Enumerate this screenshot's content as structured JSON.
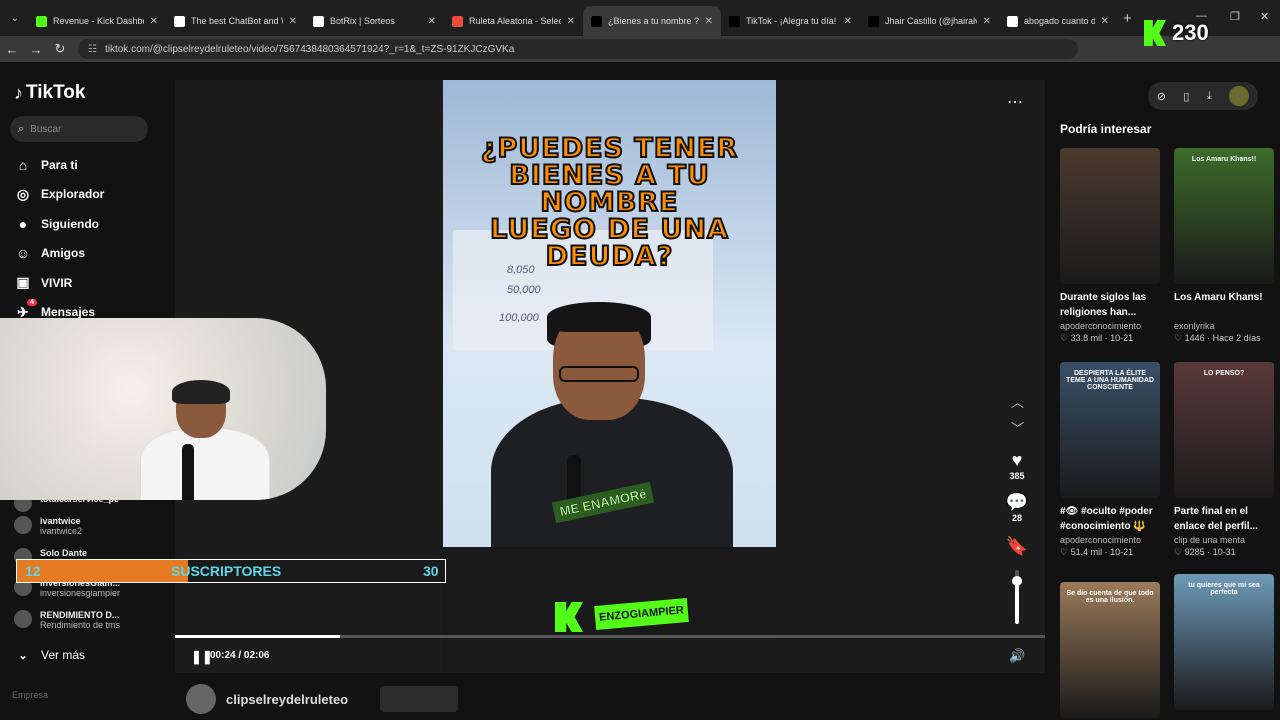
{
  "browser": {
    "tabs": [
      {
        "title": "Revenue - Kick Dashboard",
        "favicon": "kick",
        "active": false
      },
      {
        "title": "The best ChatBot and Wi",
        "favicon": "botrix",
        "active": false
      },
      {
        "title": "BotRix | Sorteos",
        "favicon": "botrix",
        "active": false
      },
      {
        "title": "Ruleta Aleatoria - Selector",
        "favicon": "wheel",
        "active": false
      },
      {
        "title": "¿Bienes a tu nombre ?",
        "favicon": "tiktok",
        "active": true
      },
      {
        "title": "TikTok - ¡Alegra tu día!",
        "favicon": "tiktok",
        "active": false
      },
      {
        "title": "Jhair Castillo (@jhairalvan",
        "favicon": "tiktok",
        "active": false
      },
      {
        "title": "abogado cuanto declara",
        "favicon": "google",
        "active": false
      }
    ],
    "url": "tiktok.com/@clipselreydelruleteo/video/7567438480364571924?_r=1&_t=ZS-91ZKJCzGVKa"
  },
  "overlay": {
    "kick_count": "230",
    "subs_current": "12",
    "subs_label": "SUSCRIPTORES",
    "subs_goal": "30",
    "subs_progress": 0.4
  },
  "sidebar": {
    "logo": "TikTok",
    "search_placeholder": "Buscar",
    "nav": [
      {
        "label": "Para ti",
        "icon": "home-icon"
      },
      {
        "label": "Explorador",
        "icon": "compass-icon"
      },
      {
        "label": "Siguiendo",
        "icon": "following-icon"
      },
      {
        "label": "Amigos",
        "icon": "friends-icon"
      },
      {
        "label": "VIVIR",
        "icon": "live-icon"
      },
      {
        "label": "Mensajes",
        "icon": "messages-icon",
        "badge": "4"
      }
    ],
    "following": [
      {
        "name": "totalcarservice_pe",
        "sub": ""
      },
      {
        "name": "ivantwice",
        "sub": "ivantwice2"
      },
      {
        "name": "Solo Dante",
        "sub": ""
      },
      {
        "name": "inversionesGiam...",
        "sub": "inversionesgiampier"
      },
      {
        "name": "RENDIMIENTO D...",
        "sub": "Rendimiento de tms"
      }
    ],
    "see_more": "Ver más",
    "footer": "Empresa"
  },
  "video": {
    "headline_lines": [
      "¿PUEDES TENER",
      "BIENES A TU",
      "NOMBRE",
      "LUEGO DE UNA",
      "DEUDA?"
    ],
    "sticker": "ME ENAMORé",
    "channel_tag": "ENZOGIAMPIER",
    "time": "00:24 / 02:06",
    "progress": 0.19,
    "likes": "385",
    "comments": "28",
    "volume": 0.8,
    "author": "clipselreydelruleteo"
  },
  "right": {
    "title": "Podría interesar",
    "cards": [
      {
        "caption": "Durante siglos las religiones han...",
        "author": "apoderconocimiento",
        "likes": "33.8 mil",
        "date": "10-21",
        "thumb_color": "#4a3a30"
      },
      {
        "caption": "Los Amaru Khans!",
        "author": "exonlyrika",
        "likes": "1446",
        "date": "Hace 2 días",
        "thumb_color": "#3e6b2a",
        "thumb_text": "Los Amaru Khans!!"
      },
      {
        "caption": "#👁 #oculto #poder #conocimiento 🔱",
        "author": "apoderconocimiento",
        "likes": "51.4 mil",
        "date": "10-21",
        "thumb_color": "#3a5068",
        "thumb_text": "DESPIERTA LA ÉLITE TEME A UNA HUMANIDAD CONSCIENTE"
      },
      {
        "caption": "Parte final en el enlace del perfil...",
        "author": "clip de una menta",
        "likes": "9285",
        "date": "10-31",
        "thumb_color": "#5a3a3a",
        "thumb_text": "LO PENSO?"
      },
      {
        "caption": "",
        "author": "",
        "likes": "",
        "date": "",
        "thumb_color": "#9a7a5a",
        "thumb_text": "Se dio cuenta de que todo es una ilusión."
      },
      {
        "caption": "",
        "author": "",
        "likes": "",
        "date": "",
        "thumb_color": "#6e9ab8",
        "thumb_text": "tu quieres que mi sea perfecta"
      }
    ]
  }
}
